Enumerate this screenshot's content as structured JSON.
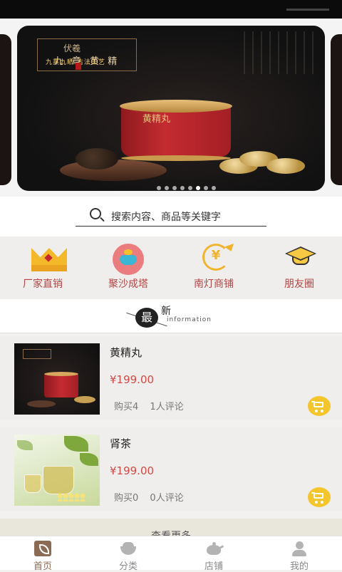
{
  "banner": {
    "brand_top": "伏羲",
    "brand_main": "九 章 黄 精",
    "brand_sub": "九蒸九晒 古法工艺",
    "tin_label": "黄精丸",
    "slide_count": 8,
    "active_slide": 6
  },
  "search": {
    "placeholder": "搜索内容、商品等关键字"
  },
  "quick_nav": [
    {
      "label": "厂家直销",
      "icon": "crown-icon"
    },
    {
      "label": "聚沙成塔",
      "icon": "pot-icon"
    },
    {
      "label": "南灯商铺",
      "icon": "yen-coin-icon"
    },
    {
      "label": "朋友圈",
      "icon": "graduation-cap-icon"
    }
  ],
  "section": {
    "char_1": "最",
    "char_2": "新",
    "sub": "information"
  },
  "products": [
    {
      "name": "黄精丸",
      "price": "¥199.00",
      "bought": "购买4",
      "reviews": "1人评论"
    },
    {
      "name": "肾茶",
      "price": "¥199.00",
      "bought": "购买0",
      "reviews": "0人评论"
    }
  ],
  "more_label": "查看更多",
  "tabs": [
    {
      "label": "首页",
      "icon": "home-icon",
      "active": true
    },
    {
      "label": "分类",
      "icon": "category-icon",
      "active": false
    },
    {
      "label": "店铺",
      "icon": "teapot-icon",
      "active": false
    },
    {
      "label": "我的",
      "icon": "user-icon",
      "active": false
    }
  ],
  "colors": {
    "accent_gold": "#f4c52c",
    "price_red": "#d14a45",
    "nav_label_red": "#b04545",
    "tab_active": "#8c6b54"
  }
}
